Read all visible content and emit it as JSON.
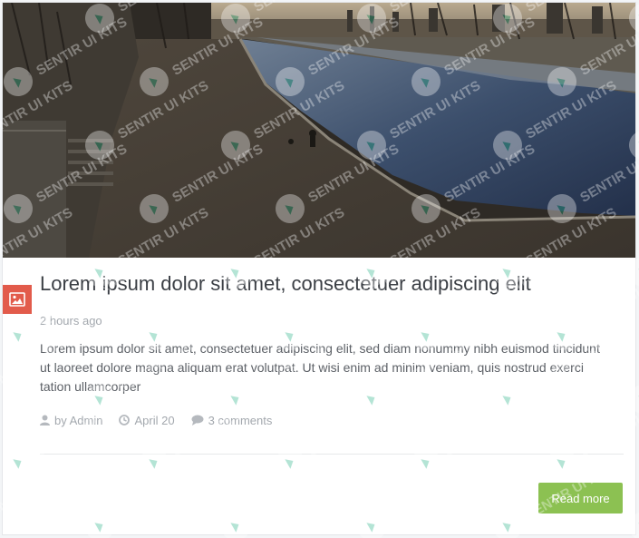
{
  "post": {
    "title": "Lorem ipsum dolor sit amet, consectetuer adipiscing elit",
    "time_ago": "2 hours ago",
    "excerpt": "Lorem ipsum dolor sit amet, consectetuer adipiscing elit, sed diam nonummy nibh euismod tincidunt ut laoreet dolore magna aliquam erat volutpat. Ut wisi enim ad minim veniam, quis nostrud exerci tation ullamcorper",
    "author": "by Admin",
    "date": "April 20",
    "comments": "3 comments",
    "read_more_label": "Read more"
  },
  "watermark": {
    "text": "SENTIR UI KITS"
  },
  "icons": {
    "post_type": "image-icon",
    "author": "user-icon",
    "date": "clock-icon",
    "comments": "comment-icon"
  },
  "colors": {
    "badge": "#e25b4b",
    "button": "#8cc152"
  }
}
